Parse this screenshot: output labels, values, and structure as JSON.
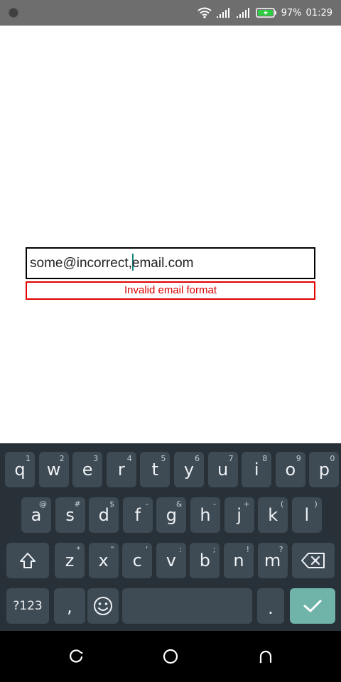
{
  "status_bar": {
    "battery": "97%",
    "time": "01:29"
  },
  "form": {
    "email_before_caret": "some@incorrect,",
    "email_after_caret": "email.com",
    "error_message": "Invalid email format"
  },
  "keyboard": {
    "row1": [
      {
        "key": "q",
        "sub": "1"
      },
      {
        "key": "w",
        "sub": "2"
      },
      {
        "key": "e",
        "sub": "3"
      },
      {
        "key": "r",
        "sub": "4"
      },
      {
        "key": "t",
        "sub": "5"
      },
      {
        "key": "y",
        "sub": "6"
      },
      {
        "key": "u",
        "sub": "7"
      },
      {
        "key": "i",
        "sub": "8"
      },
      {
        "key": "o",
        "sub": "9"
      },
      {
        "key": "p",
        "sub": "0"
      }
    ],
    "row2": [
      {
        "key": "a",
        "sub": "@"
      },
      {
        "key": "s",
        "sub": "#"
      },
      {
        "key": "d",
        "sub": "$"
      },
      {
        "key": "f",
        "sub": "-"
      },
      {
        "key": "g",
        "sub": "&"
      },
      {
        "key": "h",
        "sub": "-"
      },
      {
        "key": "j",
        "sub": "+"
      },
      {
        "key": "k",
        "sub": "("
      },
      {
        "key": "l",
        "sub": ")"
      }
    ],
    "row3": [
      {
        "key": "z",
        "sub": "*"
      },
      {
        "key": "x",
        "sub": "\""
      },
      {
        "key": "c",
        "sub": "'"
      },
      {
        "key": "v",
        "sub": ":"
      },
      {
        "key": "b",
        "sub": ";"
      },
      {
        "key": "n",
        "sub": "!"
      },
      {
        "key": "m",
        "sub": "?"
      }
    ],
    "symbols_label": "?123",
    "comma_label": ",",
    "period_label": ".",
    "icons": {
      "shift": "shift-icon",
      "backspace": "backspace-icon",
      "emoji": "emoji-icon",
      "enter": "checkmark-icon"
    }
  },
  "colors": {
    "status_bar": "#6e6e6e",
    "keyboard_bg": "#283138",
    "key_bg": "#3e4a54",
    "enter_key": "#6fb3a9",
    "error_red": "#e00000",
    "caret": "#12857c"
  }
}
